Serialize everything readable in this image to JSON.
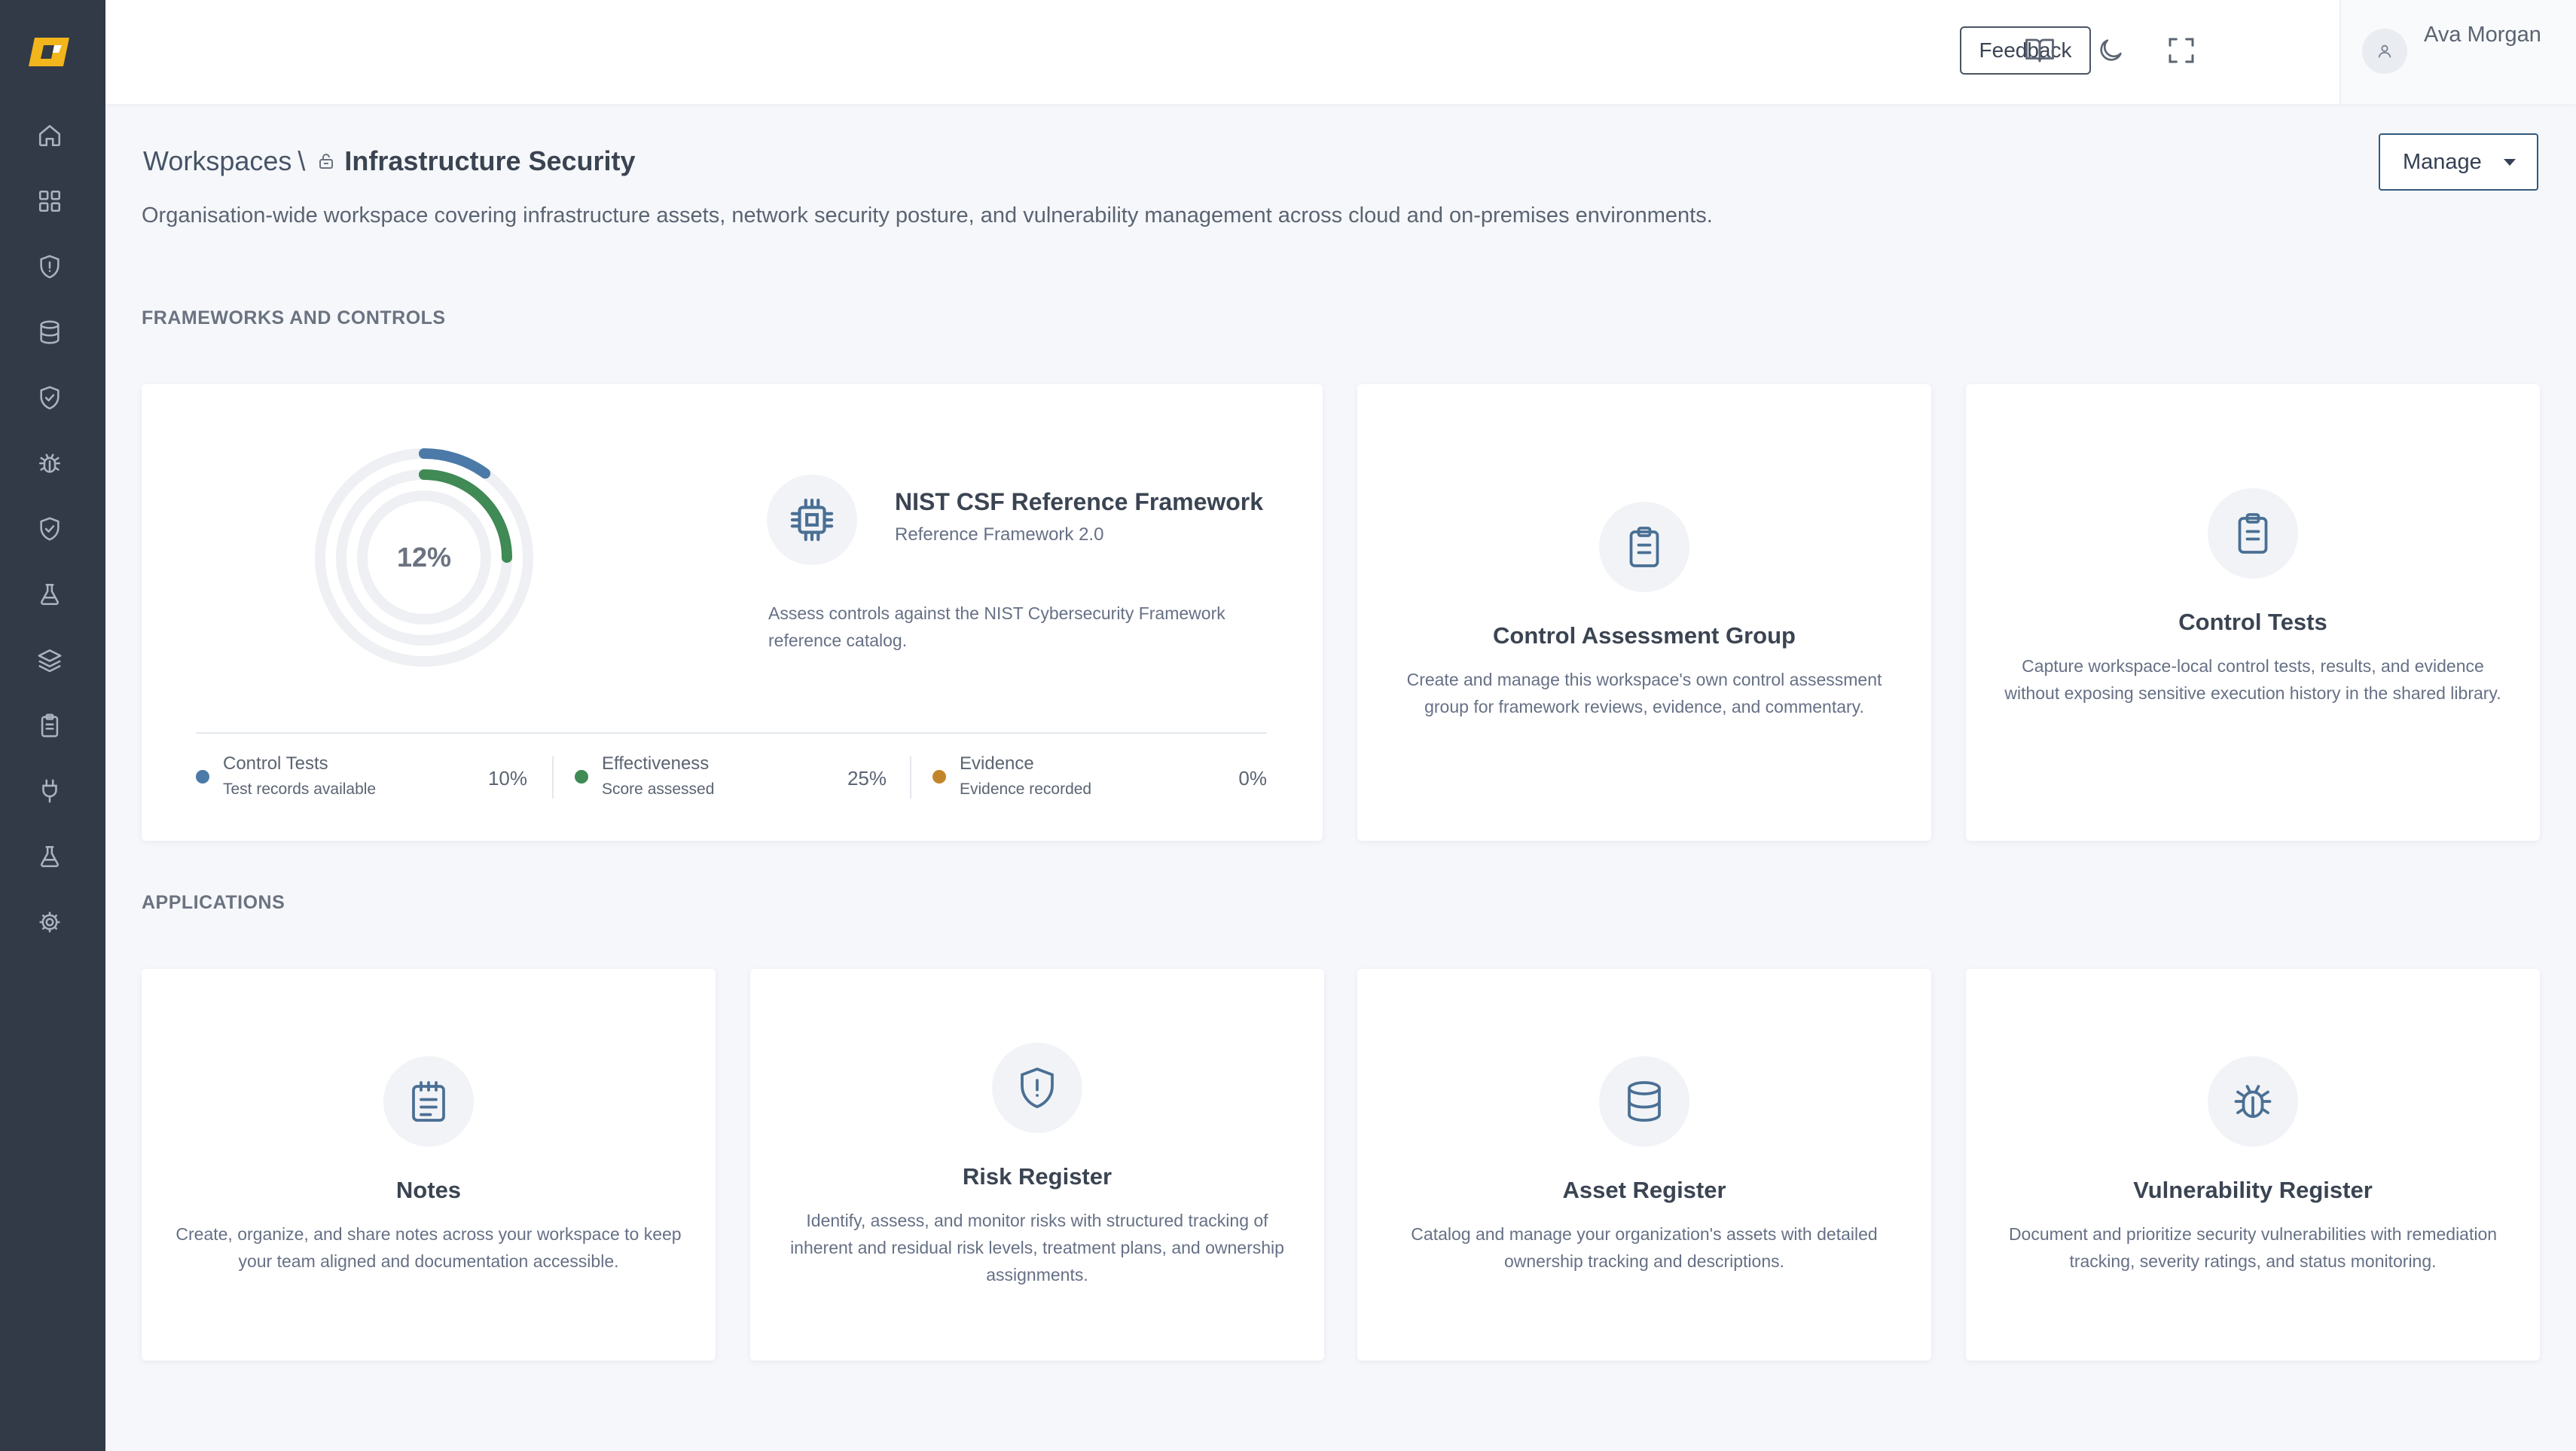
{
  "sidebar": {
    "items": [
      {
        "icon": "home-icon"
      },
      {
        "icon": "grid-icon"
      },
      {
        "icon": "shield-alert-icon"
      },
      {
        "icon": "database-icon"
      },
      {
        "icon": "shield-check-icon"
      },
      {
        "icon": "bug-icon"
      },
      {
        "icon": "shield-check-icon"
      },
      {
        "icon": "flask-icon"
      },
      {
        "icon": "layers-icon"
      },
      {
        "icon": "clipboard-icon"
      },
      {
        "icon": "plug-icon"
      },
      {
        "icon": "flask-icon"
      },
      {
        "icon": "gear-icon"
      }
    ]
  },
  "topbar": {
    "feedback_label": "Feedback",
    "user_name": "Ava Morgan"
  },
  "header": {
    "breadcrumb_root": "Workspaces",
    "breadcrumb_sep": "\\",
    "workspace_name": "Infrastructure Security",
    "manage_label": "Manage",
    "description": "Organisation-wide workspace covering infrastructure assets, network security posture, and vulnerability management across cloud and on-premises environments."
  },
  "sections": {
    "frameworks_title": "FRAMEWORKS AND CONTROLS",
    "applications_title": "APPLICATIONS"
  },
  "framework": {
    "overall_percent": "12%",
    "title": "NIST CSF Reference Framework",
    "subtitle": "Reference Framework 2.0",
    "description": "Assess controls against the NIST Cybersecurity Framework reference catalog.",
    "progress": {
      "control_tests": 0.1,
      "effectiveness": 0.25,
      "evidence": 0.0
    },
    "metrics": [
      {
        "name": "Control Tests",
        "sub": "Test records available",
        "value": "10%",
        "color": "#4b7aa8"
      },
      {
        "name": "Effectiveness",
        "sub": "Score assessed",
        "value": "25%",
        "color": "#3f8a55"
      },
      {
        "name": "Evidence",
        "sub": "Evidence recorded",
        "value": "0%",
        "color": "#c2862a"
      }
    ]
  },
  "control_cards": [
    {
      "title": "Control Assessment Group",
      "description": "Create and manage this workspace's own control assessment group for framework reviews, evidence, and commentary."
    },
    {
      "title": "Control Tests",
      "description": "Capture workspace-local control tests, results, and evidence without exposing sensitive execution history in the shared library."
    }
  ],
  "applications": [
    {
      "title": "Notes",
      "description": "Create, organize, and share notes across your workspace to keep your team aligned and documentation accessible."
    },
    {
      "title": "Risk Register",
      "description": "Identify, assess, and monitor risks with structured tracking of inherent and residual risk levels, treatment plans, and ownership assignments."
    },
    {
      "title": "Asset Register",
      "description": "Catalog and manage your organization's assets with detailed ownership tracking and descriptions."
    },
    {
      "title": "Vulnerability Register",
      "description": "Document and prioritize security vulnerabilities with remediation tracking, severity ratings, and status monitoring."
    }
  ],
  "colors": {
    "sidebar_bg": "#313a46",
    "accent_blue": "#4b7aa8",
    "accent_green": "#3f8a55",
    "accent_amber": "#c2862a",
    "icon_blue": "#4a6f94"
  }
}
